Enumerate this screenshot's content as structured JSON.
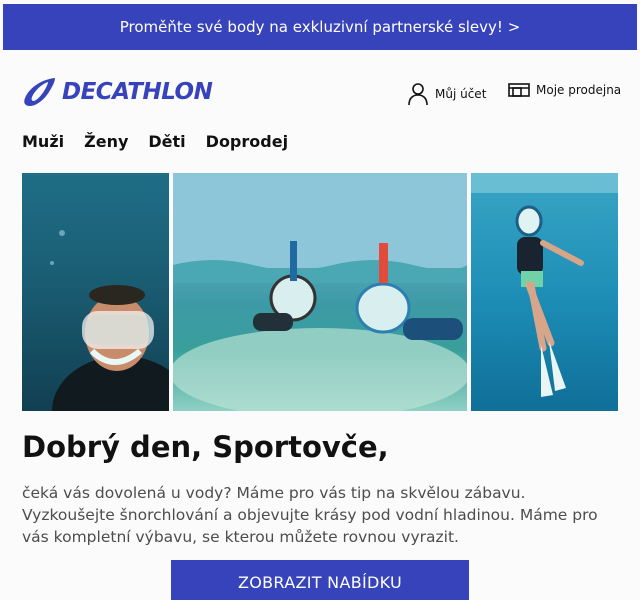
{
  "promo": {
    "text": "Proměňte své body na exkluzivní partnerské slevy! >"
  },
  "brand": {
    "logo_text": "DECATHLON",
    "color": "#3643ba"
  },
  "header": {
    "account_label": "Můj účet",
    "account_icon": "user-icon",
    "store_label": "Moje prodejna",
    "store_icon": "store-icon"
  },
  "nav": {
    "items": [
      {
        "label": "Muži"
      },
      {
        "label": "Ženy"
      },
      {
        "label": "Děti"
      },
      {
        "label": "Doprodej"
      }
    ]
  },
  "main": {
    "greeting": "Dobrý den, Sportovče,",
    "body": "čeká vás dovolená u vody? Máme pro vás tip na skvělou zábavu. Vyzkoušejte šnorchlování a objevujte krásy pod vodní hladinou. Máme pro vás kompletní výbavu, se kterou můžete rovnou vyrazit.",
    "cta_label": "ZOBRAZIT NABÍDKU"
  }
}
